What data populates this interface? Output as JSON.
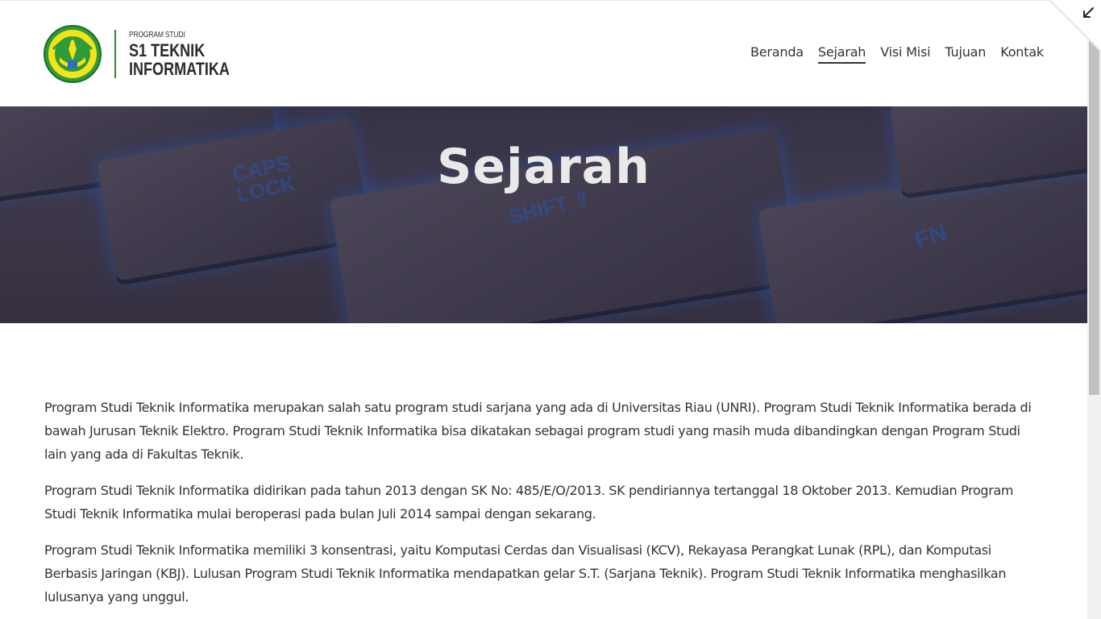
{
  "brand": {
    "small_label": "PROGRAM STUDI",
    "line1": "S1 TEKNIK",
    "line2": "INFORMATIKA",
    "accent": "#2e8b3c"
  },
  "nav": {
    "items": [
      {
        "label": "Beranda"
      },
      {
        "label": "Sejarah",
        "active": true
      },
      {
        "label": "Visi Misi"
      },
      {
        "label": "Tujuan"
      },
      {
        "label": "Kontak"
      }
    ]
  },
  "hero": {
    "title": "Sejarah",
    "key_labels": {
      "caps": "CAPS LOCK",
      "shift": "SHIFT ⇧",
      "fn": "FN"
    }
  },
  "content": {
    "paragraphs": [
      "Program Studi Teknik Informatika merupakan salah satu program studi sarjana yang ada di Universitas Riau (UNRI). Program Studi Teknik Informatika berada di bawah Jurusan Teknik Elektro. Program Studi Teknik Informatika bisa dikatakan sebagai program studi yang masih muda dibandingkan dengan Program Studi lain yang ada di Fakultas Teknik.",
      "Program Studi Teknik Informatika didirikan pada tahun 2013 dengan SK No: 485/E/O/2013. SK pendiriannya tertanggal 18 Oktober 2013. Kemudian Program Studi Teknik Informatika mulai beroperasi pada bulan Juli 2014 sampai dengan sekarang.",
      "Program Studi Teknik Informatika memiliki 3 konsentrasi, yaitu Komputasi Cerdas dan Visualisasi (KCV), Rekayasa Perangkat Lunak (RPL), dan Komputasi Berbasis Jaringan (KBJ). Lulusan Program Studi Teknik Informatika mendapatkan gelar S.T. (Sarjana Teknik). Program Studi Teknik Informatika menghasilkan lulusanya yang unggul."
    ]
  },
  "icons": {
    "logo": "university-emblem",
    "corner": "collapse-arrow-icon"
  }
}
